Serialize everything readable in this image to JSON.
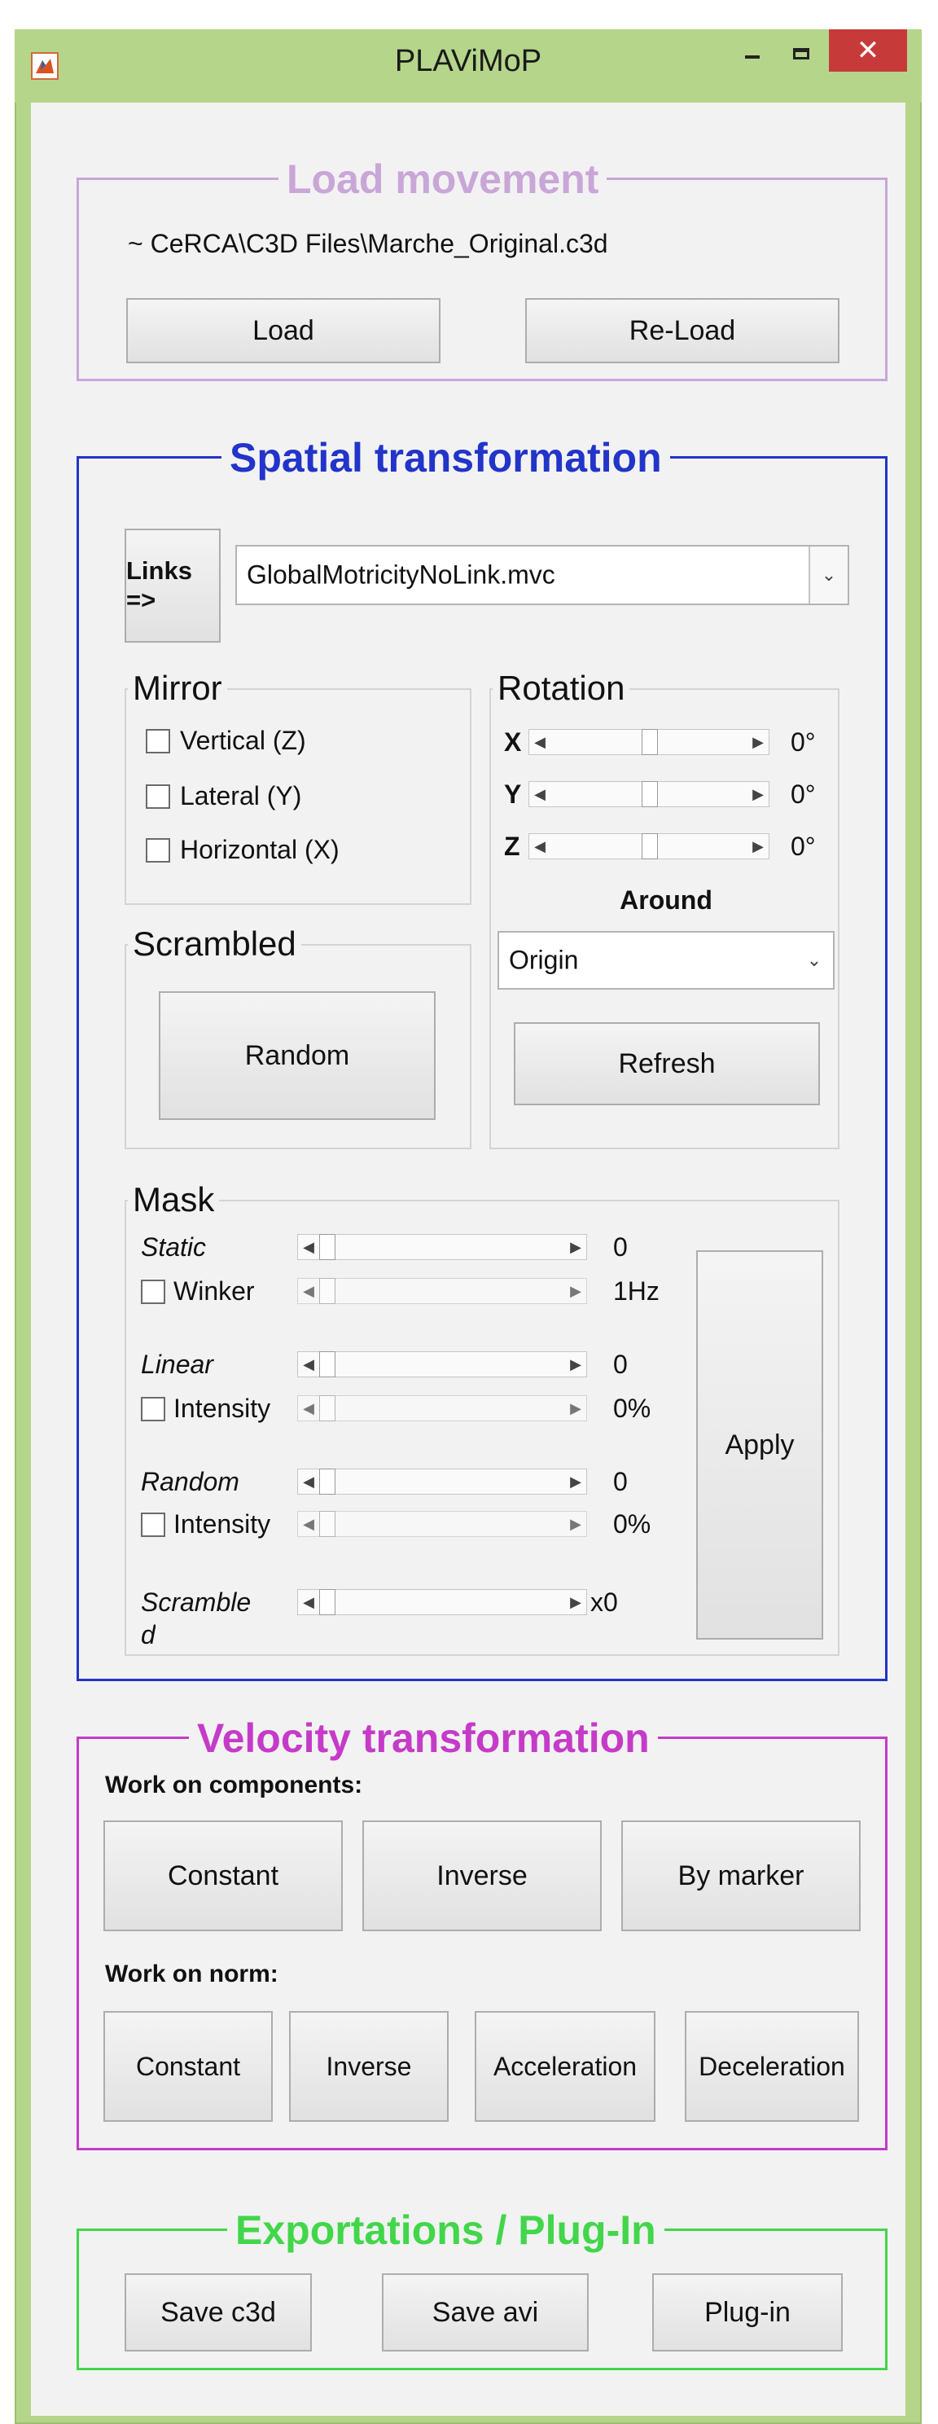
{
  "window": {
    "title": "PLAViMoP"
  },
  "colors": {
    "load": "#c9a6d8",
    "spatial": "#2234c9",
    "velocity": "#c53bc8",
    "export": "#42d64a",
    "frame": "#b5d68a"
  },
  "load_movement": {
    "title": "Load movement",
    "file_path": "~ CeRCA\\C3D Files\\Marche_Original.c3d",
    "load_label": "Load",
    "reload_label": "Re-Load"
  },
  "spatial": {
    "title": "Spatial transformation",
    "links_label": "Links =>",
    "links_file": "GlobalMotricityNoLink.mvc",
    "mirror": {
      "title": "Mirror",
      "vertical": "Vertical (Z)",
      "lateral": "Lateral (Y)",
      "horizontal": "Horizontal (X)"
    },
    "rotation": {
      "title": "Rotation",
      "x_label": "X",
      "y_label": "Y",
      "z_label": "Z",
      "x_value": "0°",
      "y_value": "0°",
      "z_value": "0°",
      "around_label": "Around",
      "around_value": "Origin",
      "refresh_label": "Refresh"
    },
    "scrambled": {
      "title": "Scrambled",
      "random_label": "Random"
    },
    "mask": {
      "title": "Mask",
      "static_label": "Static",
      "static_value": "0",
      "winker_label": "Winker",
      "winker_value": "1Hz",
      "linear_label": "Linear",
      "linear_value": "0",
      "linear_intensity_label": "Intensity",
      "linear_intensity_value": "0%",
      "random_label": "Random",
      "random_value": "0",
      "random_intensity_label": "Intensity",
      "random_intensity_value": "0%",
      "scrambled_label": "Scramble",
      "scrambled_label_cont": "d",
      "scrambled_value": "x0",
      "apply_label": "Apply"
    }
  },
  "velocity": {
    "title": "Velocity transformation",
    "components_label": "Work on components:",
    "components": [
      "Constant",
      "Inverse",
      "By marker"
    ],
    "norm_label": "Work on norm:",
    "norm": [
      "Constant",
      "Inverse",
      "Acceleration",
      "Deceleration"
    ]
  },
  "exports": {
    "title": "Exportations / Plug-In",
    "save_c3d": "Save c3d",
    "save_avi": "Save avi",
    "plugin": "Plug-in"
  }
}
